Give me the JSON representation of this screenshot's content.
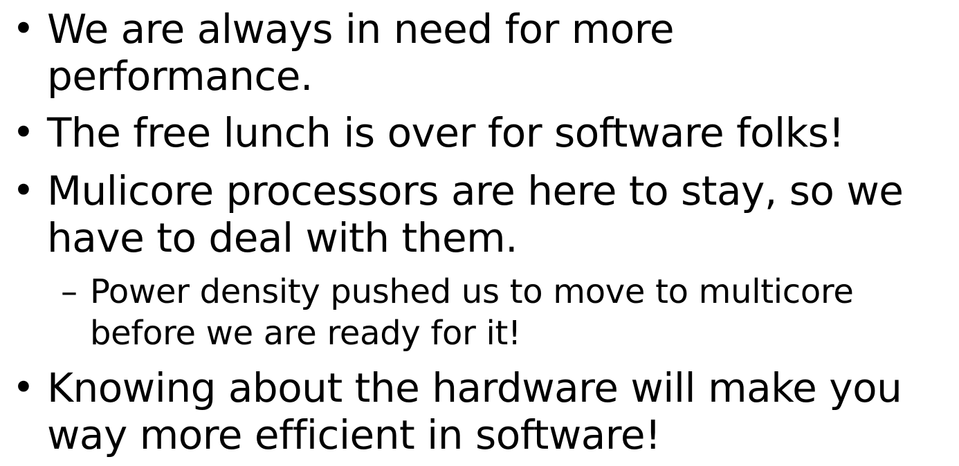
{
  "slide": {
    "bullets": [
      {
        "lines": [
          "We are always in need for more",
          "performance."
        ]
      },
      {
        "lines": [
          "The free lunch is over for software folks!"
        ]
      },
      {
        "lines": [
          "Mulicore processors are here to stay, so we",
          "have to deal with them."
        ],
        "sub": {
          "marker": "–",
          "lines": [
            "Power density pushed us to move to multicore",
            "before we are ready for it!"
          ]
        }
      },
      {
        "lines": [
          "Knowing about the hardware will make you",
          "way more efficient in software!"
        ]
      }
    ],
    "bullet_marker": "•"
  }
}
